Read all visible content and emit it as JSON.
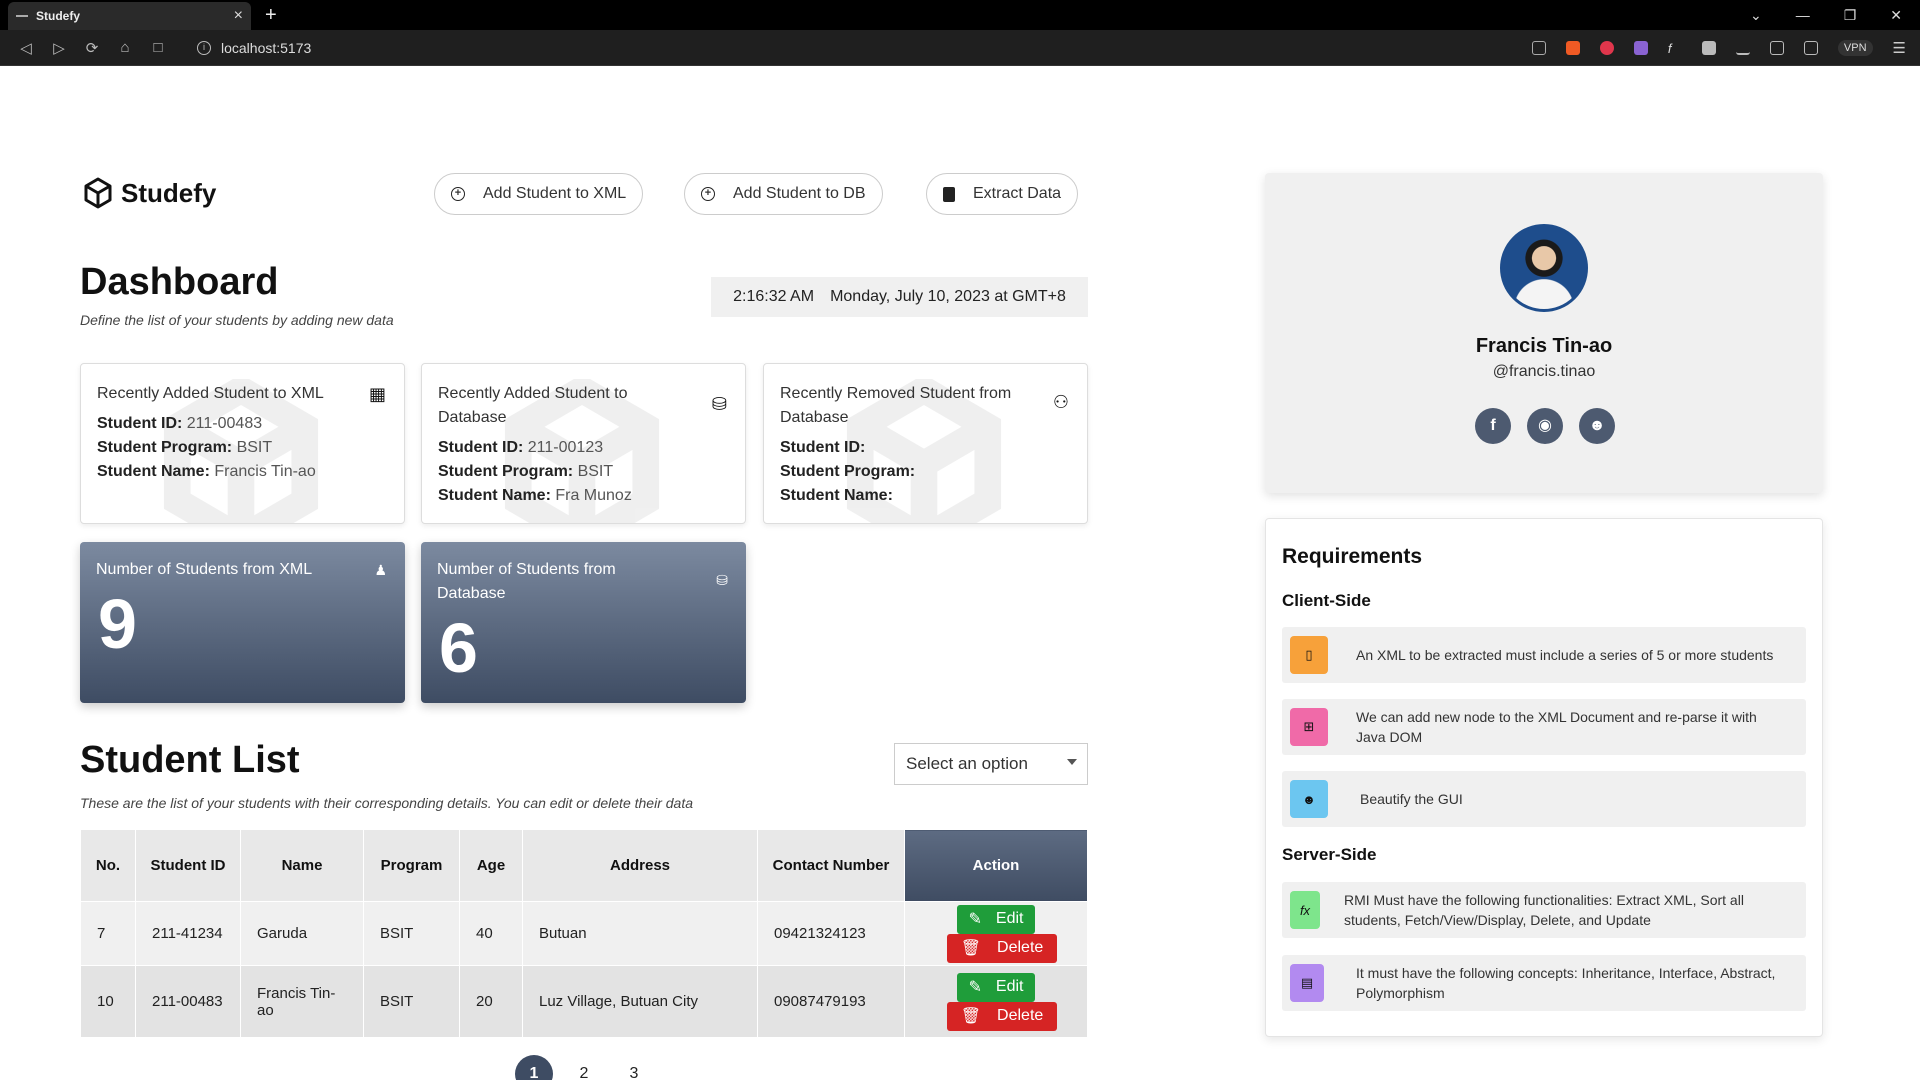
{
  "browser": {
    "tab_title": "Studefy",
    "tab_close": "×",
    "new_tab": "+",
    "url": "localhost:5173",
    "vpn_label": "VPN"
  },
  "app": {
    "brand": "Studefy",
    "buttons": {
      "add_xml": "Add Student to XML",
      "add_db": "Add Student to DB",
      "extract": "Extract Data"
    }
  },
  "dashboard": {
    "title": "Dashboard",
    "subtitle": "Define the list of your students by adding new data",
    "time": "2:16:32 AM",
    "date": "Monday, July 10, 2023 at GMT+8"
  },
  "cards": [
    {
      "title": "Recently Added Student to XML",
      "id_label": "Student ID:",
      "id_value": "211-00483",
      "program_label": "Student Program:",
      "program_value": "BSIT",
      "name_label": "Student Name:",
      "name_value": "Francis Tin-ao"
    },
    {
      "title": "Recently Added Student to Database",
      "id_label": "Student ID:",
      "id_value": "211-00123",
      "program_label": "Student Program:",
      "program_value": "BSIT",
      "name_label": "Student Name:",
      "name_value": "Fra Munoz"
    },
    {
      "title": "Recently Removed Student from Database",
      "id_label": "Student ID:",
      "id_value": "",
      "program_label": "Student Program:",
      "program_value": "",
      "name_label": "Student Name:",
      "name_value": ""
    }
  ],
  "stats": [
    {
      "title": "Number of Students from XML",
      "value": "9"
    },
    {
      "title": "Number of Students from Database",
      "value": "6"
    }
  ],
  "student_list": {
    "title": "Student List",
    "subtitle": "These are the list of your students with their corresponding details. You can edit or delete their data",
    "select_placeholder": "Select an option",
    "columns": [
      "No.",
      "Student ID",
      "Name",
      "Program",
      "Age",
      "Address",
      "Contact Number",
      "Action"
    ],
    "rows": [
      {
        "no": "7",
        "id": "211-41234",
        "name": "Garuda",
        "program": "BSIT",
        "age": "40",
        "address": "Butuan",
        "contact": "09421324123"
      },
      {
        "no": "10",
        "id": "211-00483",
        "name": "Francis Tin-ao",
        "program": "BSIT",
        "age": "20",
        "address": "Luz Village, Butuan City",
        "contact": "09087479193"
      }
    ],
    "edit_label": "Edit",
    "delete_label": "Delete",
    "pages": [
      "1",
      "2",
      "3"
    ],
    "active_page": "1"
  },
  "profile": {
    "name": "Francis Tin-ao",
    "handle": "@francis.tinao",
    "socials": [
      "facebook-icon",
      "chrome-icon",
      "github-icon"
    ]
  },
  "requirements": {
    "title": "Requirements",
    "client_title": "Client-Side",
    "server_title": "Server-Side",
    "client": [
      {
        "text": "An XML to be extracted must include a series of 5 or more students",
        "color": "#f7a13a"
      },
      {
        "text": "We can add new node to the XML Document and re-parse it with Java DOM",
        "color": "#f06aa8"
      },
      {
        "text": "Beautify the GUI",
        "color": "#6cc6f0"
      }
    ],
    "server": [
      {
        "text": "RMI Must have the following functionalities: Extract XML, Sort all students, Fetch/View/Display, Delete, and Update",
        "color": "#7ee58c"
      },
      {
        "text": "It must have the following concepts: Inheritance, Interface, Abstract, Polymorphism",
        "color": "#b28af0"
      }
    ]
  }
}
